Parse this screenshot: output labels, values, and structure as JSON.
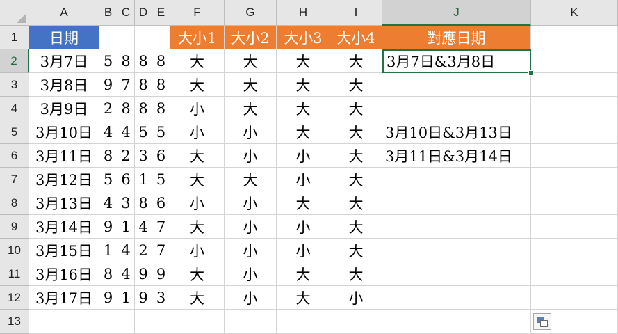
{
  "columns": [
    "A",
    "B",
    "C",
    "D",
    "E",
    "F",
    "G",
    "H",
    "I",
    "J",
    "K"
  ],
  "rows": [
    "1",
    "2",
    "3",
    "4",
    "5",
    "6",
    "7",
    "8",
    "9",
    "10",
    "11",
    "12",
    "13"
  ],
  "header_row": {
    "A": "日期",
    "F": "大小1",
    "G": "大小2",
    "H": "大小3",
    "I": "大小4",
    "J": "對應日期"
  },
  "data_rows": [
    {
      "date": "3月7日",
      "d": [
        "5",
        "8",
        "8",
        "8"
      ],
      "size": [
        "大",
        "大",
        "大",
        "大"
      ],
      "match": "3月7日&3月8日"
    },
    {
      "date": "3月8日",
      "d": [
        "9",
        "7",
        "8",
        "8"
      ],
      "size": [
        "大",
        "大",
        "大",
        "大"
      ],
      "match": ""
    },
    {
      "date": "3月9日",
      "d": [
        "2",
        "8",
        "8",
        "8"
      ],
      "size": [
        "小",
        "大",
        "大",
        "大"
      ],
      "match": ""
    },
    {
      "date": "3月10日",
      "d": [
        "4",
        "4",
        "5",
        "5"
      ],
      "size": [
        "小",
        "小",
        "大",
        "大"
      ],
      "match": "3月10日&3月13日"
    },
    {
      "date": "3月11日",
      "d": [
        "8",
        "2",
        "3",
        "6"
      ],
      "size": [
        "大",
        "小",
        "小",
        "大"
      ],
      "match": "3月11日&3月14日"
    },
    {
      "date": "3月12日",
      "d": [
        "5",
        "6",
        "1",
        "5"
      ],
      "size": [
        "大",
        "大",
        "小",
        "大"
      ],
      "match": ""
    },
    {
      "date": "3月13日",
      "d": [
        "4",
        "3",
        "8",
        "6"
      ],
      "size": [
        "小",
        "小",
        "大",
        "大"
      ],
      "match": ""
    },
    {
      "date": "3月14日",
      "d": [
        "9",
        "1",
        "4",
        "7"
      ],
      "size": [
        "大",
        "小",
        "小",
        "大"
      ],
      "match": ""
    },
    {
      "date": "3月15日",
      "d": [
        "1",
        "4",
        "2",
        "7"
      ],
      "size": [
        "小",
        "小",
        "小",
        "大"
      ],
      "match": ""
    },
    {
      "date": "3月16日",
      "d": [
        "8",
        "4",
        "9",
        "9"
      ],
      "size": [
        "大",
        "小",
        "大",
        "大"
      ],
      "match": ""
    },
    {
      "date": "3月17日",
      "d": [
        "9",
        "1",
        "9",
        "3"
      ],
      "size": [
        "大",
        "小",
        "大",
        "小"
      ],
      "match": ""
    }
  ],
  "selection": {
    "column": "J",
    "row": "2"
  },
  "colors": {
    "header_blue": "#4472c4",
    "header_orange": "#ed7d31",
    "selection_green": "#217346"
  },
  "icons": {
    "paste_options": "paste-options-icon",
    "select_all": "select-all-triangle-icon"
  }
}
